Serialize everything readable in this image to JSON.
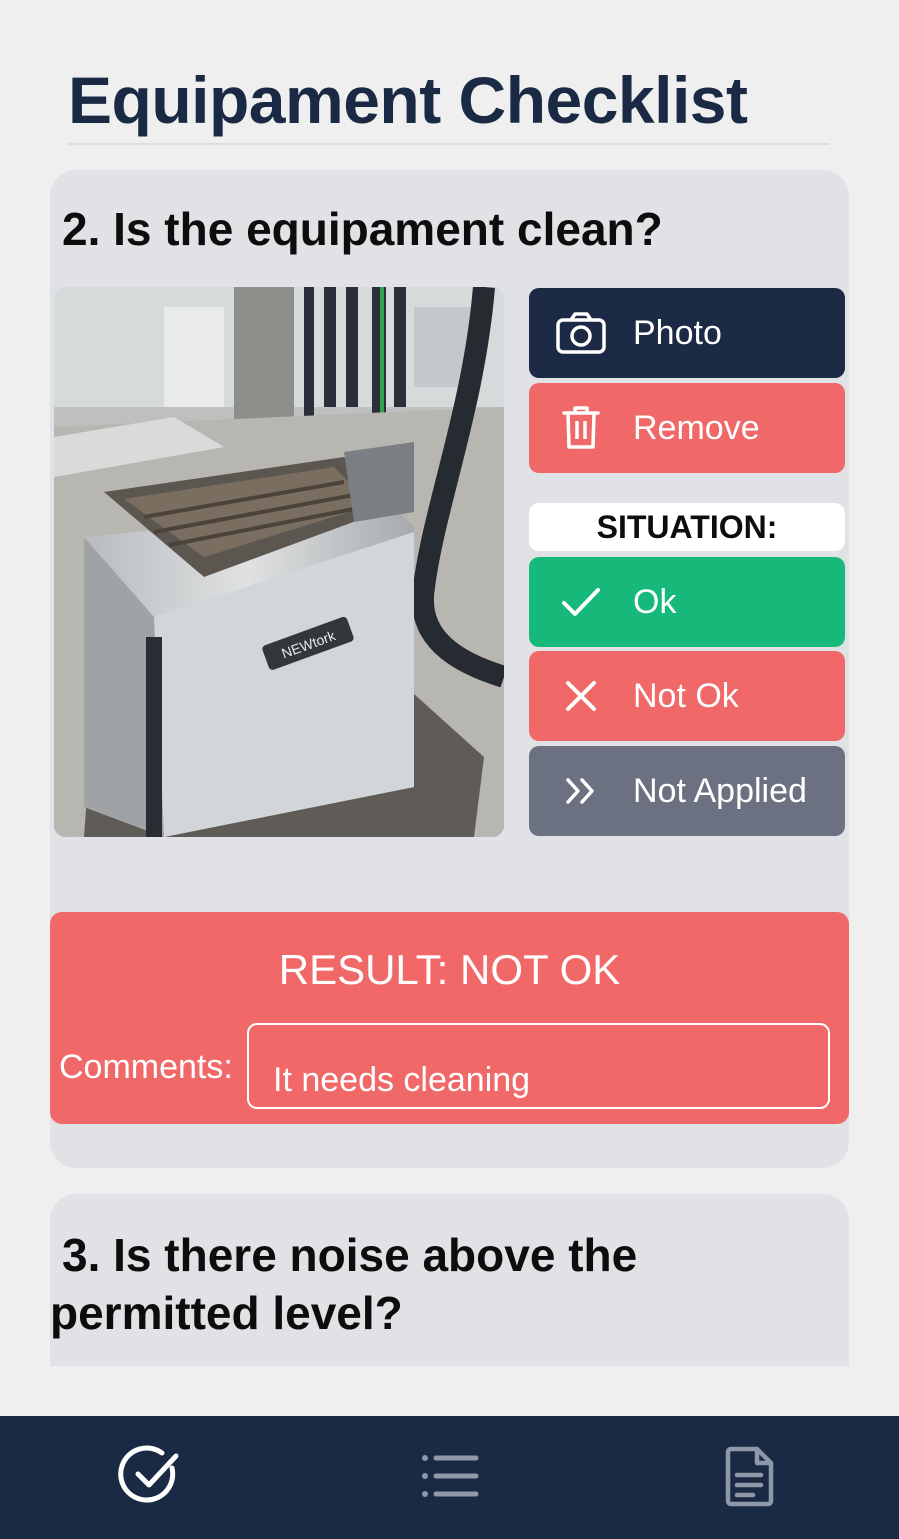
{
  "header": {
    "title": "Equipament Checklist"
  },
  "question2": {
    "title": "2. Is the equipament clean?",
    "photo_button": "Photo",
    "remove_button": "Remove",
    "situation_label": "SITUATION:",
    "options": {
      "ok": "Ok",
      "not_ok": "Not Ok",
      "not_applied": "Not Applied"
    },
    "result": "RESULT: NOT OK",
    "comments_label": "Comments:",
    "comments_value": "It needs cleaning",
    "photo_brand_text": "NEWtork"
  },
  "question3": {
    "title": "3. Is there noise above the permitted level?"
  },
  "bottom_nav": {
    "icons": [
      "check-circle-icon",
      "list-icon",
      "document-icon"
    ]
  },
  "colors": {
    "navy": "#1b2a44",
    "red": "#f16868",
    "green": "#17b97a",
    "gray": "#6b7180",
    "card": "#e1e2e5"
  }
}
